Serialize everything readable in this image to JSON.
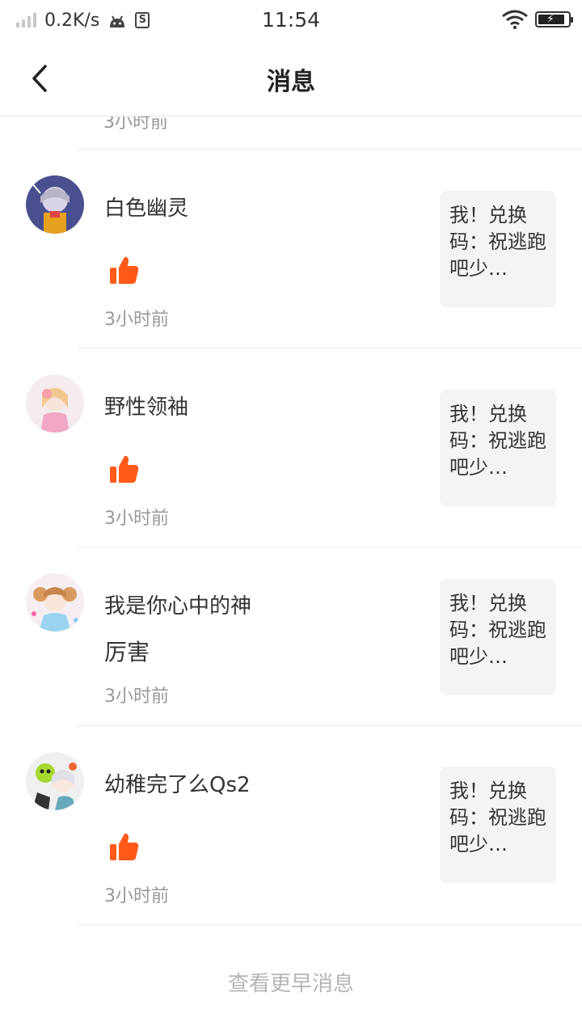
{
  "status_bar": {
    "speed": "0.2K/s",
    "s_badge": "S",
    "time": "11:54"
  },
  "nav": {
    "title": "消息"
  },
  "partial_item": {
    "time": "3小时前"
  },
  "items": [
    {
      "name": "白色幽灵",
      "reaction": "like",
      "time": "3小时前",
      "post_excerpt": "我！兑换码：祝逃跑吧少…"
    },
    {
      "name": "野性领袖",
      "reaction": "like",
      "time": "3小时前",
      "post_excerpt": "我！兑换码：祝逃跑吧少…"
    },
    {
      "name": "我是你心中的神",
      "reaction": "comment",
      "comment": "厉害",
      "time": "3小时前",
      "post_excerpt": "我！兑换码：祝逃跑吧少…"
    },
    {
      "name": "幼稚完了么Qs2",
      "reaction": "like",
      "time": "3小时前",
      "post_excerpt": "我！兑换码：祝逃跑吧少…"
    }
  ],
  "footer": {
    "more_label": "查看更早消息"
  },
  "colors": {
    "like": "#ff5a1a",
    "secondary_text": "#999999",
    "card_bg": "#f4f4f4"
  }
}
